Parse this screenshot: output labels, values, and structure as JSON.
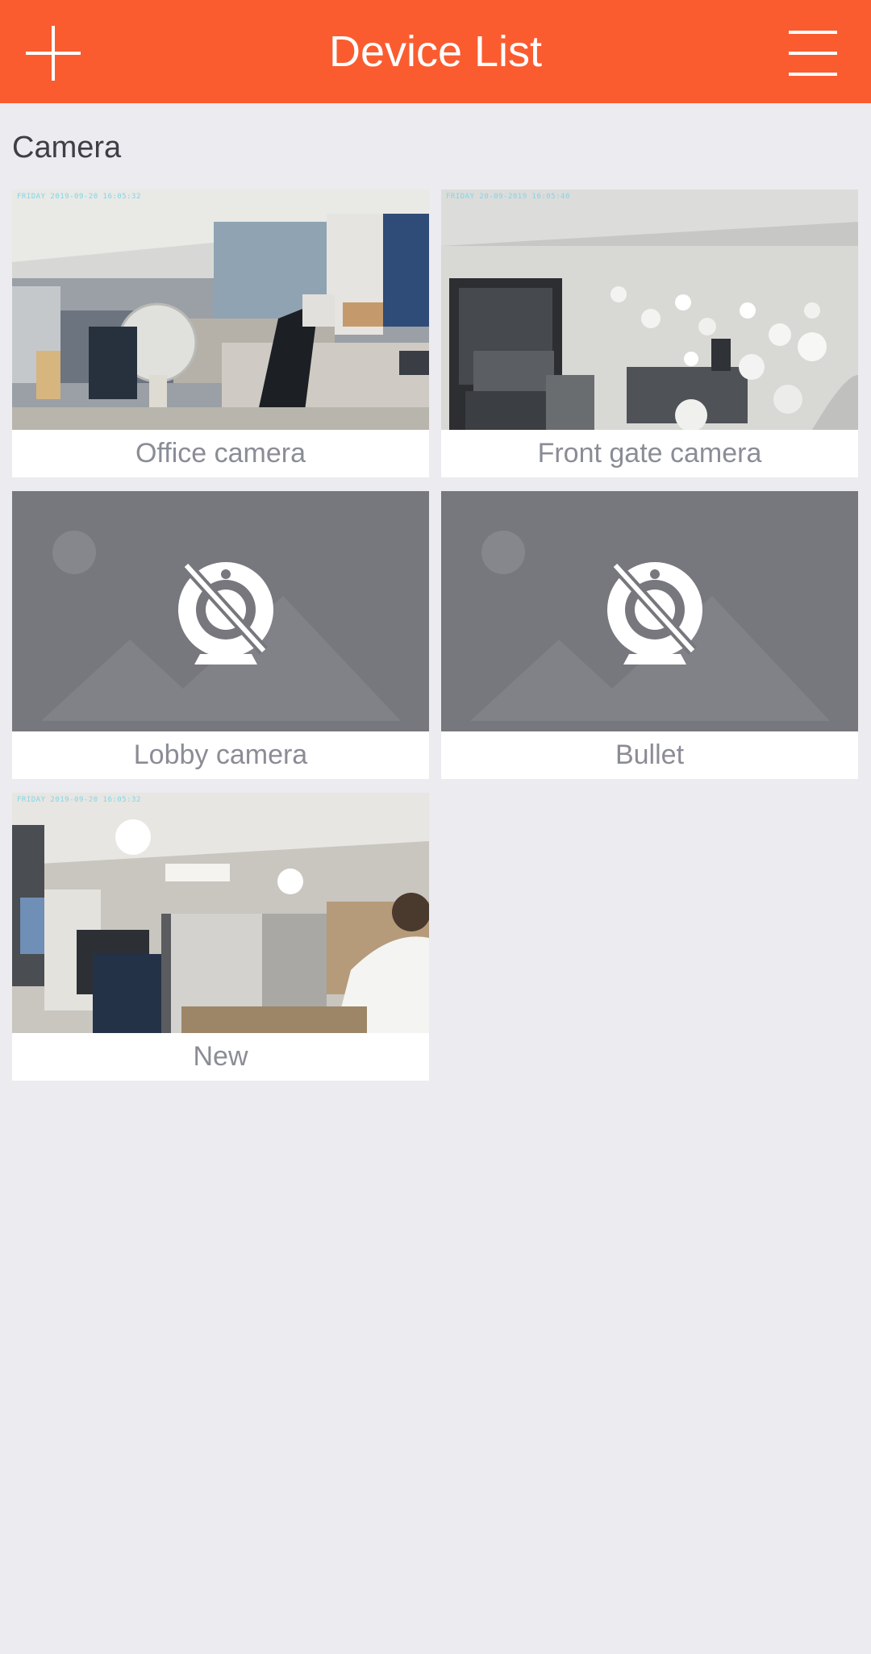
{
  "app_bar": {
    "title": "Device List",
    "add_icon": "plus-icon",
    "menu_icon": "hamburger-menu-icon",
    "color": "#fa5c30"
  },
  "section": {
    "title": "Camera"
  },
  "devices": [
    {
      "name": "Office camera",
      "status": "preview",
      "osd": "FRIDAY 2019-09-20 16:05:32"
    },
    {
      "name": "Front gate camera",
      "status": "preview",
      "osd": "FRIDAY 20-09-2019 16:05:40"
    },
    {
      "name": "Lobby camera",
      "status": "offline",
      "icon": "camera-offline-icon"
    },
    {
      "name": "Bullet",
      "status": "offline",
      "icon": "camera-offline-icon"
    },
    {
      "name": "New",
      "status": "preview",
      "osd": "FRIDAY 2019-09-20 16:05:32"
    }
  ],
  "colors": {
    "background": "#ebebf0",
    "card_label": "#8a8d96",
    "placeholder": "#77787e"
  }
}
